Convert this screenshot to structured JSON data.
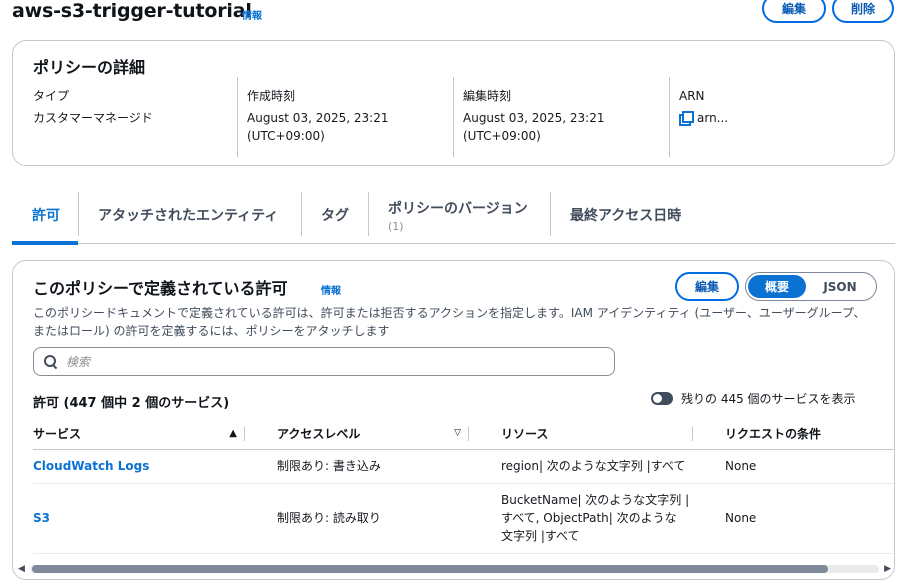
{
  "header": {
    "title": "aws-s3-trigger-tutorial",
    "info_label": "情報",
    "edit_label": "編集",
    "delete_label": "削除"
  },
  "details": {
    "title": "ポリシーの詳細",
    "type_label": "タイプ",
    "type_value": "カスタマーマネージド",
    "created_label": "作成時刻",
    "created_value_line1": "August 03, 2025, 23:21",
    "created_value_line2": "(UTC+09:00)",
    "edited_label": "編集時刻",
    "edited_value_line1": "August 03, 2025, 23:21",
    "edited_value_line2": "(UTC+09:00)",
    "arn_label": "ARN",
    "arn_value": "arn..."
  },
  "tabs": [
    {
      "label": "許可",
      "count": ""
    },
    {
      "label": "アタッチされたエンティティ",
      "count": ""
    },
    {
      "label": "タグ",
      "count": ""
    },
    {
      "label": "ポリシーのバージョン",
      "count": "(1)"
    },
    {
      "label": "最終アクセス日時",
      "count": ""
    }
  ],
  "permissions": {
    "title": "このポリシーで定義されている許可",
    "info_label": "情報",
    "edit_label": "編集",
    "view_summary": "概要",
    "view_json": "JSON",
    "description": "このポリシードキュメントで定義されている許可は、許可または拒否するアクションを指定します。IAM アイデンティティ (ユーザー、ユーザーグループ、またはロール) の許可を定義するには、ポリシーをアタッチします",
    "search_placeholder": "検索",
    "count_text": "許可 (447 個中 2 個のサービス)",
    "toggle_label": "残りの 445 個のサービスを表示",
    "columns": [
      "サービス",
      "アクセスレベル",
      "リソース",
      "リクエストの条件"
    ],
    "rows": [
      {
        "service": "CloudWatch Logs",
        "access": "制限あり: 書き込み",
        "resource": "region| 次のような文字列 |すべて",
        "condition": "None"
      },
      {
        "service": "S3",
        "access": "制限あり: 読み取り",
        "resource_line1": "BucketName| 次のような文字列 |",
        "resource_line2": "すべて, ObjectPath| 次のような",
        "resource_line3": "文字列 |すべて",
        "condition": "None"
      }
    ]
  },
  "colors": {
    "accent": "#0972d3",
    "border": "#c6c6cd",
    "text": "#16191f"
  }
}
